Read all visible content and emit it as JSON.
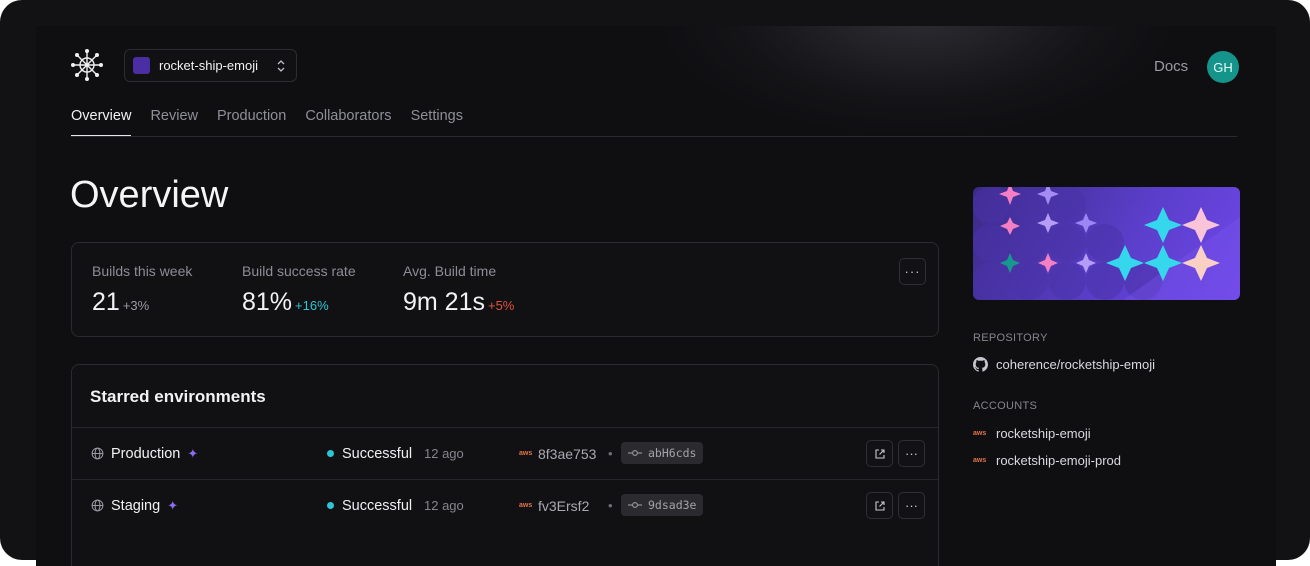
{
  "header": {
    "project_name": "rocket-ship-emoji",
    "docs_label": "Docs",
    "avatar_initials": "GH"
  },
  "tabs": [
    {
      "label": "Overview",
      "active": true
    },
    {
      "label": "Review",
      "active": false
    },
    {
      "label": "Production",
      "active": false
    },
    {
      "label": "Collaborators",
      "active": false
    },
    {
      "label": "Settings",
      "active": false
    }
  ],
  "page_title": "Overview",
  "stats": [
    {
      "label": "Builds this week",
      "value": "21",
      "delta": "+3%",
      "delta_color": "#9a9aa2"
    },
    {
      "label": "Build success rate",
      "value": "81%",
      "delta": "+16%",
      "delta_color": "#2dc5d4"
    },
    {
      "label": "Avg. Build time",
      "value": "9m 21s",
      "delta": "+5%",
      "delta_color": "#e0523d"
    }
  ],
  "stats_more_label": "···",
  "starred": {
    "title": "Starred environments",
    "rows": [
      {
        "name": "Production",
        "status": "Successful",
        "ago": "12 ago",
        "provider": "aws",
        "commit": "8f3ae753",
        "separator": "•",
        "hash": "abH6cds"
      },
      {
        "name": "Staging",
        "status": "Successful",
        "ago": "12 ago",
        "provider": "aws",
        "commit": "fv3Ersf2",
        "separator": "•",
        "hash": "9dsad3e"
      }
    ]
  },
  "sidebar": {
    "repository_label": "REPOSITORY",
    "repository": "coherence/rocketship-emoji",
    "accounts_label": "ACCOUNTS",
    "accounts": [
      {
        "provider": "aws",
        "name": "rocketship-emoji"
      },
      {
        "provider": "aws",
        "name": "rocketship-emoji-prod"
      }
    ]
  },
  "colors": {
    "accent_purple": "#5a3ec9",
    "success_teal": "#2dc5d4",
    "avatar_teal": "#14948a",
    "negative_red": "#e0523d"
  },
  "icons": [
    "logo-icon",
    "chevron-updown-icon",
    "globe-icon",
    "sparkle-icon",
    "aws-icon",
    "commit-icon",
    "external-link-icon",
    "more-icon",
    "github-icon"
  ]
}
